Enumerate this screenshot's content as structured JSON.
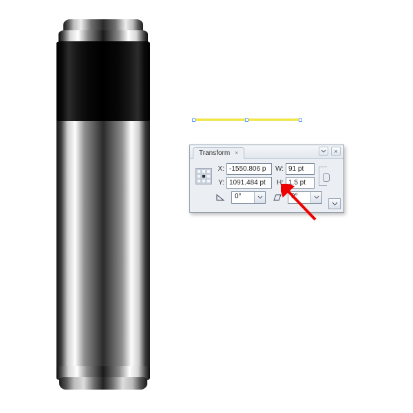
{
  "panel": {
    "title": "Transform",
    "x_label": "X:",
    "y_label": "Y:",
    "w_label": "W:",
    "h_label": "H:",
    "x_value": "-1550.806 p",
    "y_value": "1091.484 pt",
    "w_value": "91 pt",
    "h_value": "1.5 pt",
    "angle_value": "0°",
    "shear_value": "0°"
  }
}
